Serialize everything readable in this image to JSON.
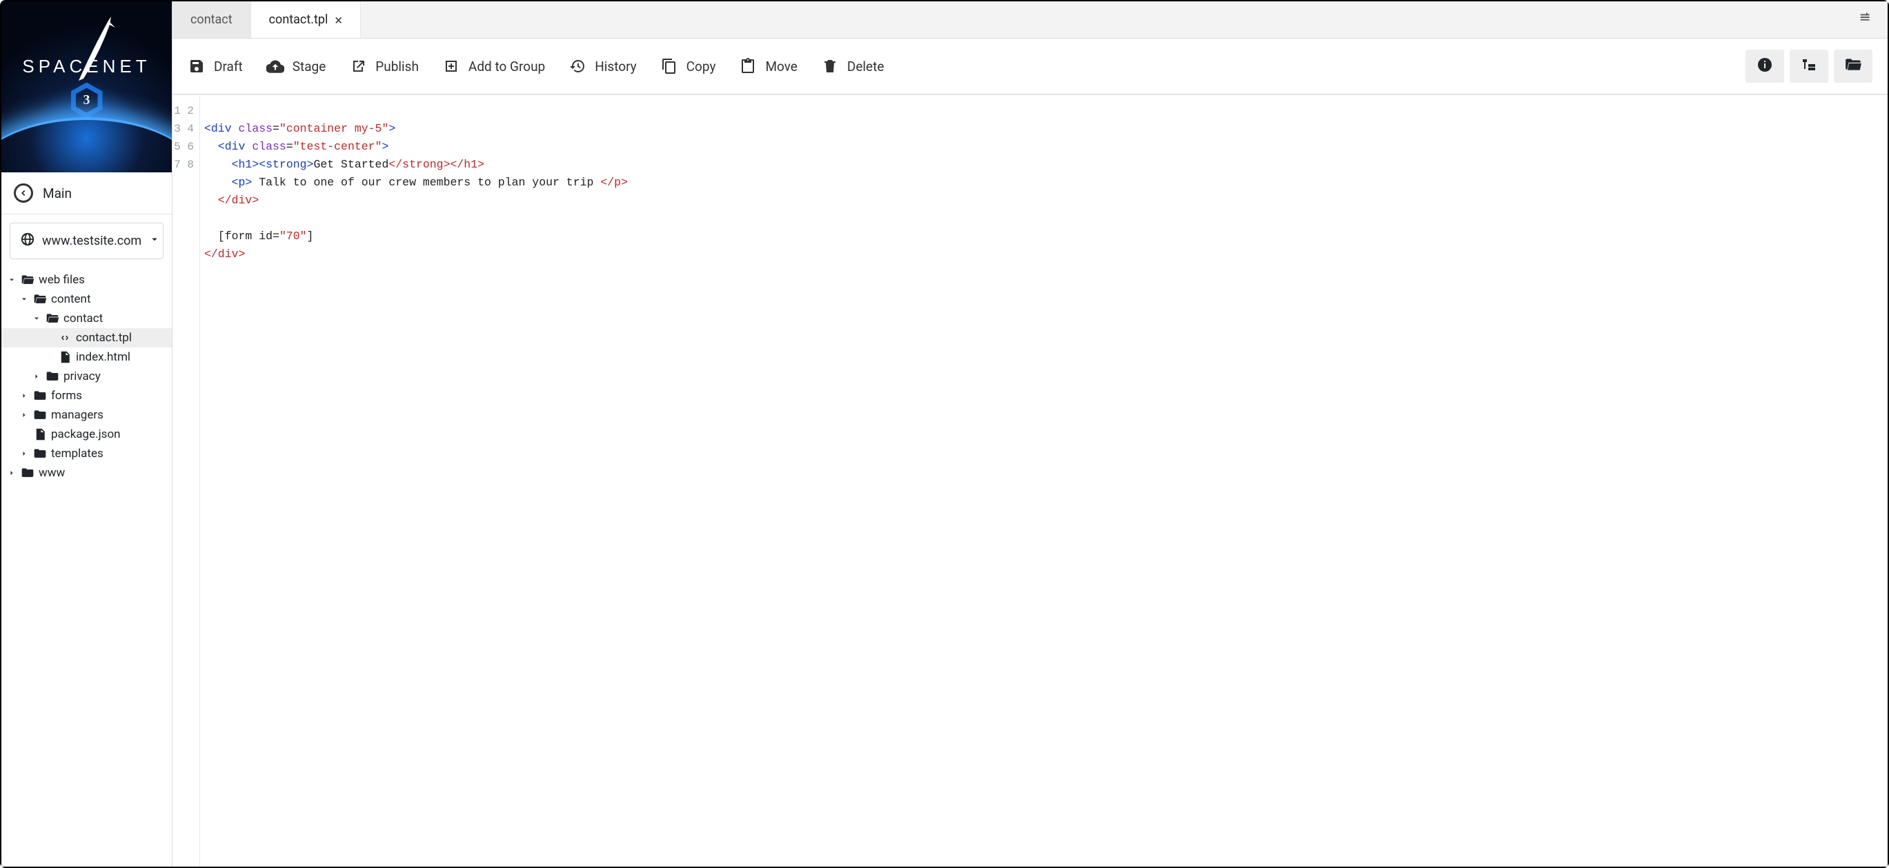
{
  "logo": {
    "name": "SPACENET",
    "badge": "3"
  },
  "sidebar": {
    "main_label": "Main",
    "site_url": "www.testsite.com",
    "tree": [
      {
        "label": "web files",
        "depth": 0,
        "icon": "folder-open",
        "caret": "down",
        "selected": false
      },
      {
        "label": "content",
        "depth": 1,
        "icon": "folder-open",
        "caret": "down",
        "selected": false
      },
      {
        "label": "contact",
        "depth": 2,
        "icon": "folder-open",
        "caret": "down",
        "selected": false
      },
      {
        "label": "contact.tpl",
        "depth": 3,
        "icon": "code-file",
        "caret": "",
        "selected": true
      },
      {
        "label": "index.html",
        "depth": 3,
        "icon": "html-file",
        "caret": "",
        "selected": false
      },
      {
        "label": "privacy",
        "depth": 2,
        "icon": "folder",
        "caret": "right",
        "selected": false
      },
      {
        "label": "forms",
        "depth": 1,
        "icon": "folder",
        "caret": "right",
        "selected": false
      },
      {
        "label": "managers",
        "depth": 1,
        "icon": "folder",
        "caret": "right",
        "selected": false
      },
      {
        "label": "package.json",
        "depth": 1,
        "icon": "html-file",
        "caret": "",
        "selected": false
      },
      {
        "label": "templates",
        "depth": 1,
        "icon": "folder",
        "caret": "right",
        "selected": false
      },
      {
        "label": "www",
        "depth": 0,
        "icon": "folder",
        "caret": "right",
        "selected": false
      }
    ]
  },
  "tabs": [
    {
      "label": "contact",
      "active": false,
      "closable": false
    },
    {
      "label": "contact.tpl",
      "active": true,
      "closable": true
    }
  ],
  "toolbar": {
    "draft": "Draft",
    "stage": "Stage",
    "publish": "Publish",
    "add": "Add to Group",
    "history": "History",
    "copy": "Copy",
    "move": "Move",
    "delete": "Delete"
  },
  "code": {
    "line_count": 8,
    "l1": {
      "t1": "<div",
      "a1": " class",
      "eq": "=",
      "s1": "\"container my-5\"",
      "t2": ">"
    },
    "l2": {
      "indent": "  ",
      "t1": "<div",
      "a1": " class",
      "eq": "=",
      "s1": "\"test-center\"",
      "t2": ">"
    },
    "l3": {
      "indent": "    ",
      "t1": "<h1><strong>",
      "txt": "Get Started",
      "e1": "</strong>",
      "e2": "</h1>"
    },
    "l4": {
      "indent": "    ",
      "t1": "<p>",
      "txt": " Talk to one of our crew members to plan your trip ",
      "e1": "</p>"
    },
    "l5": {
      "indent": "  ",
      "e1": "</div>"
    },
    "l6": {
      "indent": ""
    },
    "l7": {
      "indent": "  ",
      "txt1": "[form id=",
      "s1": "\"70\"",
      "txt2": "]"
    },
    "l8": {
      "e1": "</div>"
    }
  }
}
